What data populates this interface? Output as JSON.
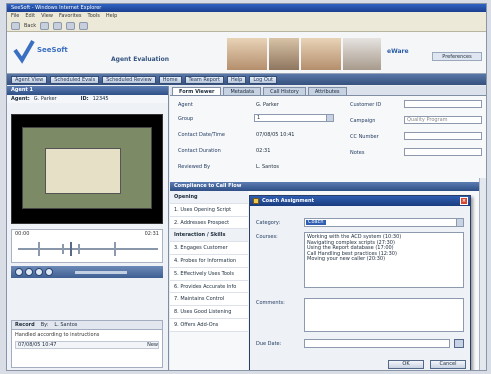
{
  "window": {
    "title": "SeeSoft - Windows Internet Explorer"
  },
  "menu": [
    "File",
    "Edit",
    "View",
    "Favorites",
    "Tools",
    "Help"
  ],
  "toolbar": {
    "back_label": "Back"
  },
  "banner": {
    "logo_text": "SeeSoft",
    "app_title": "Agent Evaluation",
    "brand": "eWare",
    "user_button": "Preferences"
  },
  "nav": {
    "items": [
      "Agent View",
      "Scheduled Evals",
      "Scheduled Review",
      "Home",
      "Team Report",
      "Help",
      "Log Out"
    ]
  },
  "left": {
    "header": "Agent 1",
    "agent_label": "Agent:",
    "agent_value": "G. Parker",
    "id_label": "ID:",
    "id_value": "12345",
    "timeline": {
      "start": "00:00",
      "end": "02:31"
    },
    "notes": {
      "tab1": "Record",
      "tab2": "By:",
      "tab3": "L. Santos",
      "text": "Handled according to instructions",
      "entry_time": "07/08/05 10:47",
      "entry_action": "New"
    }
  },
  "right": {
    "tabs": [
      "Form Viewer",
      "Metadata",
      "Call History",
      "Attributes"
    ],
    "form": {
      "agent_label": "Agent",
      "agent_value": "G. Parker",
      "group_label": "Group",
      "group_value": "1",
      "date_label": "Contact Date/Time",
      "date_value": "07/08/05 10:41",
      "duration_label": "Contact Duration",
      "duration_value": "02:31",
      "reviewed_label": "Reviewed By",
      "reviewed_value": "L. Santos",
      "customer_label": "Customer ID",
      "campaign_label": "Campaign",
      "campaign_value": "Quality Program",
      "cc_label": "CC Number",
      "notes_label": "Notes"
    },
    "grid_header": "Compliance to Call Flow",
    "questions": [
      {
        "text": "Opening",
        "section": true
      },
      {
        "text": "1. Uses Opening Script",
        "section": false
      },
      {
        "text": "2. Addresses Prospect",
        "section": false
      },
      {
        "text": "Interaction / Skills",
        "section": true
      },
      {
        "text": "3. Engages Customer",
        "section": false
      },
      {
        "text": "4. Probes for Information",
        "section": false
      },
      {
        "text": "5. Effectively Uses Tools",
        "section": false
      },
      {
        "text": "6. Provides Accurate Info",
        "section": false
      },
      {
        "text": "7. Maintains Control",
        "section": false
      },
      {
        "text": "8. Uses Good Listening",
        "section": false
      },
      {
        "text": "9. Offers Add-Ons",
        "section": false
      }
    ]
  },
  "dialog": {
    "title": "Coach Assignment",
    "category_label": "Category:",
    "category_value": "Coach",
    "courses_label": "Courses:",
    "courses": [
      "Working with the ACD system (10:30)",
      "Navigating complex scripts (27:30)",
      "Using the Report database (17:00)",
      "Call Handling best practices (12:30)",
      "Moving your new caller (20:30)"
    ],
    "comments_label": "Comments:",
    "duedate_label": "Due Date:",
    "ok_label": "OK",
    "cancel_label": "Cancel"
  }
}
